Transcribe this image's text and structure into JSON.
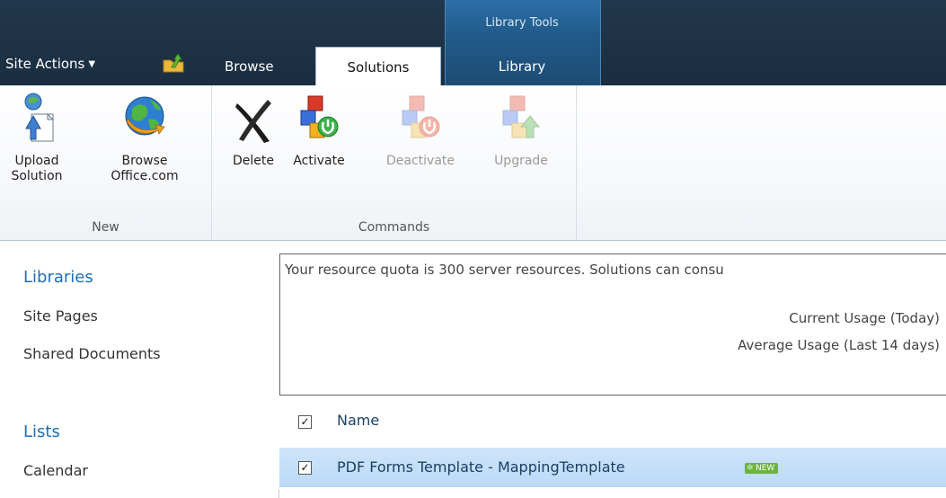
{
  "header": {
    "contextual_group": "Library Tools",
    "site_actions": "Site Actions",
    "tabs": [
      {
        "label": "Browse"
      },
      {
        "label": "Solutions"
      },
      {
        "label": "Library"
      }
    ]
  },
  "ribbon": {
    "groups": {
      "new": {
        "label": "New",
        "buttons": [
          {
            "line1": "Upload",
            "line2": "Solution",
            "icon": "upload-solution-icon"
          },
          {
            "line1": "Browse",
            "line2": "Office.com",
            "icon": "globe-icon"
          }
        ]
      },
      "commands": {
        "label": "Commands",
        "buttons": [
          {
            "label": "Delete",
            "icon": "delete-x-icon"
          },
          {
            "label": "Activate",
            "icon": "activate-icon"
          },
          {
            "label": "Deactivate",
            "icon": "deactivate-icon"
          },
          {
            "label": "Upgrade",
            "icon": "upgrade-icon"
          }
        ]
      }
    }
  },
  "leftnav": {
    "libraries_heading": "Libraries",
    "libraries": [
      "Site Pages",
      "Shared Documents"
    ],
    "lists_heading": "Lists",
    "lists": [
      "Calendar"
    ]
  },
  "quota": {
    "message": "Your resource quota is 300 server resources. Solutions can consu",
    "current_usage": "Current Usage (Today)",
    "average_usage": "Average Usage (Last 14 days)"
  },
  "list": {
    "column_name": "Name",
    "rows": [
      {
        "name": "PDF Forms Template - MappingTemplate",
        "badge": "NEW"
      }
    ]
  },
  "colors": {
    "topbar": "#21374c",
    "contextual": "#2c6fa7",
    "link": "#1e6fb8",
    "selected_row": "#cde4fa",
    "new_badge": "#6db33f"
  }
}
